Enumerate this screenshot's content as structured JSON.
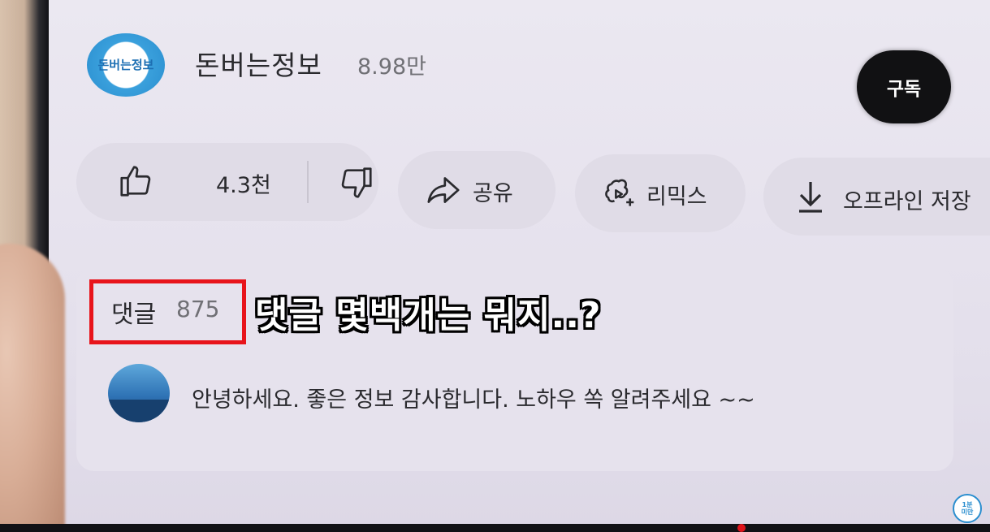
{
  "channel": {
    "logo_text": "돈버는정보",
    "name": "돈버는정보",
    "subscribers": "8.98만",
    "subscribe_label": "구독"
  },
  "actions": {
    "like_count": "4.3천",
    "share_label": "공유",
    "remix_label": "리믹스",
    "download_label": "오프라인 저장"
  },
  "comments": {
    "label": "댓글",
    "count": "875",
    "first_comment": "안녕하세요. 좋은 정보 감사합니다. 노하우 쏙 알려주세요 ~~"
  },
  "overlay": {
    "caption": "댓글 몇백개는 뭐지..?",
    "highlight_color": "#e8141b"
  },
  "watermark": {
    "line1": "1분",
    "line2": "미만"
  },
  "icons": {
    "like": "thumbs-up-icon",
    "dislike": "thumbs-down-icon",
    "share": "share-arrow-icon",
    "remix": "remix-icon",
    "download": "download-icon"
  }
}
